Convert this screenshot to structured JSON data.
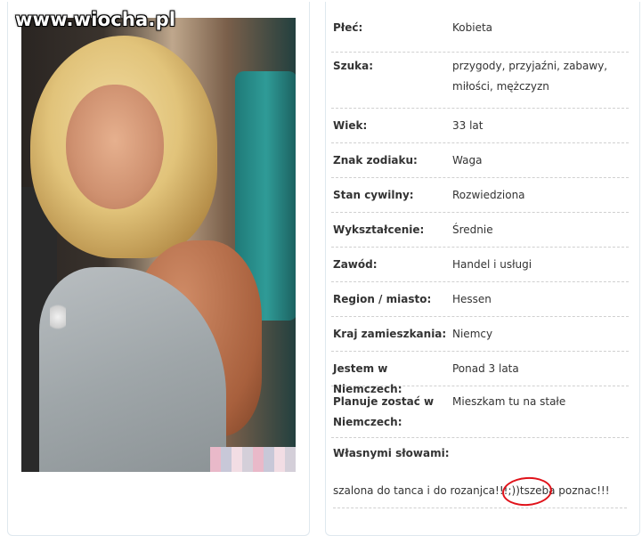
{
  "watermark": "www.wiocha.pl",
  "profile": {
    "rows": [
      {
        "label": "Płeć:",
        "value": "Kobieta"
      },
      {
        "label": "Szuka:",
        "value": "przygody, przyjaźni, zabawy, miłości, mężczyzn"
      },
      {
        "label": "Wiek:",
        "value": "33 lat"
      },
      {
        "label": "Znak zodiaku:",
        "value": "Waga"
      },
      {
        "label": "Stan cywilny:",
        "value": "Rozwiedziona"
      },
      {
        "label": "Wykształcenie:",
        "value": "Średnie"
      },
      {
        "label": "Zawód:",
        "value": "Handel i usługi"
      },
      {
        "label": "Region / miasto:",
        "value": "Hessen"
      },
      {
        "label": "Kraj zamieszkania:",
        "value": "Niemcy"
      },
      {
        "label": "Jestem w Niemczech:",
        "value": "Ponad 3 lata"
      },
      {
        "label": "Planuje zostać w Niemczech:",
        "value": "Mieszkam tu na stałe"
      },
      {
        "label": "Własnymi słowami:",
        "value": ""
      }
    ],
    "own_words": "szalona do tanca i do rozanjca!!!;))tszeba poznac!!!"
  },
  "colors": {
    "border": "#dfe8ee",
    "text": "#333333",
    "highlight_circle": "#e0121a"
  }
}
